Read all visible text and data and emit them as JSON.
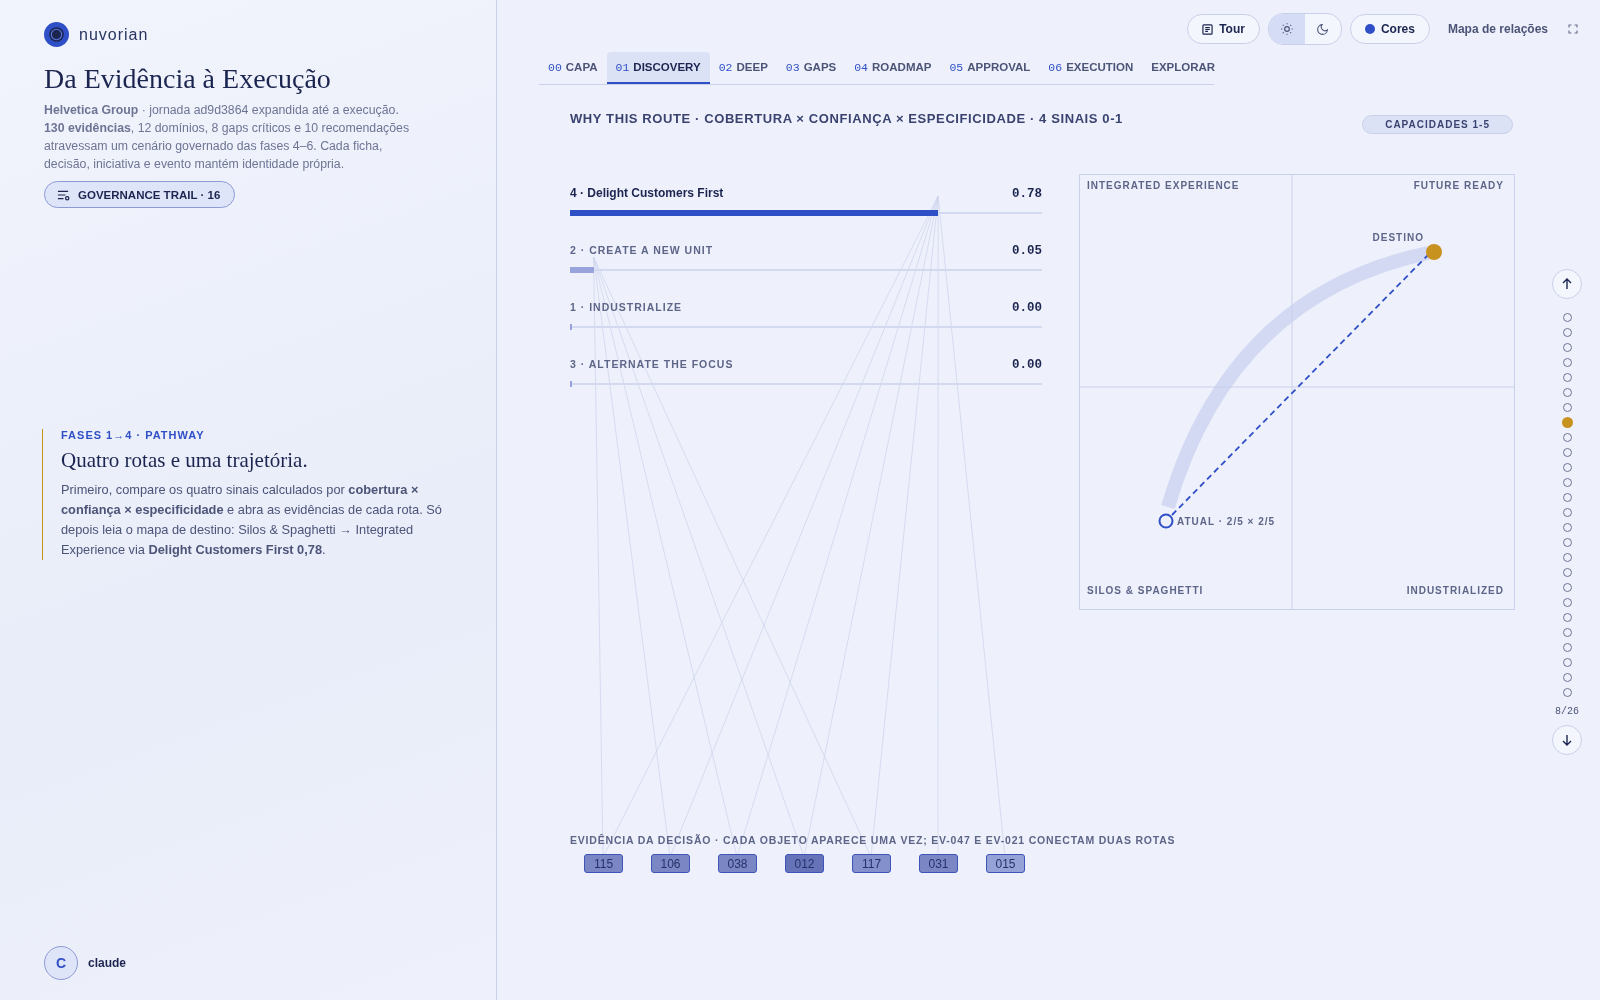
{
  "brand": {
    "name": "nuvorian"
  },
  "sidebar": {
    "title": "Da Evidência à Execução",
    "intro_lead": "**Helvetica Group** · jornada ad9d3864 expandida até a execução.",
    "intro_body": "**130 evidências**, 12 domínios, 8 gaps críticos e 10 recomendações atravessam um cenário governado das fases 4–6. Cada ficha, decisão, iniciativa e evento mantém identidade própria.",
    "trail_button": "GOVERNANCE TRAIL · 16",
    "pathway": {
      "eyebrow": "FASES 1→4 · PATHWAY",
      "heading": "Quatro rotas e uma trajetória.",
      "body": "Primeiro, compare os quatro sinais calculados por **cobertura × confiança × especificidade** e abra as evidências de cada rota. Só depois leia o mapa de destino: Silos & Spaghetti → Integrated Experience via **Delight Customers First 0,78**."
    },
    "user": {
      "initial": "C",
      "name": "claude"
    }
  },
  "toolbar": {
    "tour": "Tour",
    "theme": [
      {
        "kind": "light",
        "selected": true
      },
      {
        "kind": "dark",
        "selected": false
      }
    ],
    "colors": "Cores",
    "map_link": "Mapa de relações"
  },
  "tabs": [
    {
      "number": "00",
      "label": "CAPA",
      "selected": false
    },
    {
      "number": "01",
      "label": "DISCOVERY",
      "selected": true
    },
    {
      "number": "02",
      "label": "DEEP",
      "selected": false
    },
    {
      "number": "03",
      "label": "GAPS",
      "selected": false
    },
    {
      "number": "04",
      "label": "ROADMAP",
      "selected": false
    },
    {
      "number": "05",
      "label": "APPROVAL",
      "selected": false
    },
    {
      "number": "06",
      "label": "EXECUTION",
      "selected": false
    },
    {
      "label": "EXPLORAR",
      "selected": false
    }
  ],
  "section_title": "WHY THIS ROUTE · COBERTURA × CONFIANÇA × ESPECIFICIDADE · 4 SINAIS 0-1",
  "capacity_badge": "CAPACIDADES 1-5",
  "routes": [
    {
      "label": "4 · Delight Customers First",
      "reading": "0.78",
      "level": 0.78,
      "selected": true
    },
    {
      "label": "2 · CREATE A NEW UNIT",
      "reading": "0.05",
      "level": 0.05,
      "selected": false
    },
    {
      "label": "1 · INDUSTRIALIZE",
      "reading": "0.00",
      "level": 0,
      "selected": false
    },
    {
      "label": "3 · ALTERNATE THE FOCUS",
      "reading": "0.00",
      "level": 0,
      "selected": false
    }
  ],
  "quadrant_map": {
    "quadrants": [
      "INTEGRATED EXPERIENCE",
      "FUTURE READY",
      "SILOS & SPAGHETTI",
      "INDUSTRIALIZED"
    ],
    "target_label": "DESTINO",
    "current_label": "ATUAL · 2/5 × 2/5"
  },
  "evidence": {
    "title": "EVIDÊNCIA DA DECISÃO · CADA OBJETO APARECE UMA VEZ; EV-047 E EV-021 CONECTAM DUAS ROTAS",
    "chips": [
      {
        "label": "115",
        "color": "#7b86c4"
      },
      {
        "label": "106",
        "color": "#7b86c4"
      },
      {
        "label": "038",
        "color": "#7b86c4"
      },
      {
        "label": "012",
        "color": "#6673b8"
      },
      {
        "label": "117",
        "color": "#8390cc"
      },
      {
        "label": "031",
        "color": "#7b86c4"
      },
      {
        "label": "015",
        "color": "#95a2d8"
      }
    ]
  },
  "rail": {
    "steps": [
      {
        "selected": false
      },
      {
        "selected": false
      },
      {
        "selected": false
      },
      {
        "selected": false
      },
      {
        "selected": false
      },
      {
        "selected": false
      },
      {
        "selected": false
      },
      {
        "selected": true
      },
      {
        "selected": false
      },
      {
        "selected": false
      },
      {
        "selected": false
      },
      {
        "selected": false
      },
      {
        "selected": false
      },
      {
        "selected": false
      },
      {
        "selected": false
      },
      {
        "selected": false
      },
      {
        "selected": false
      },
      {
        "selected": false
      },
      {
        "selected": false
      },
      {
        "selected": false
      },
      {
        "selected": false
      },
      {
        "selected": false
      },
      {
        "selected": false
      },
      {
        "selected": false
      },
      {
        "selected": false
      },
      {
        "selected": false
      }
    ],
    "counter": "8/26"
  }
}
